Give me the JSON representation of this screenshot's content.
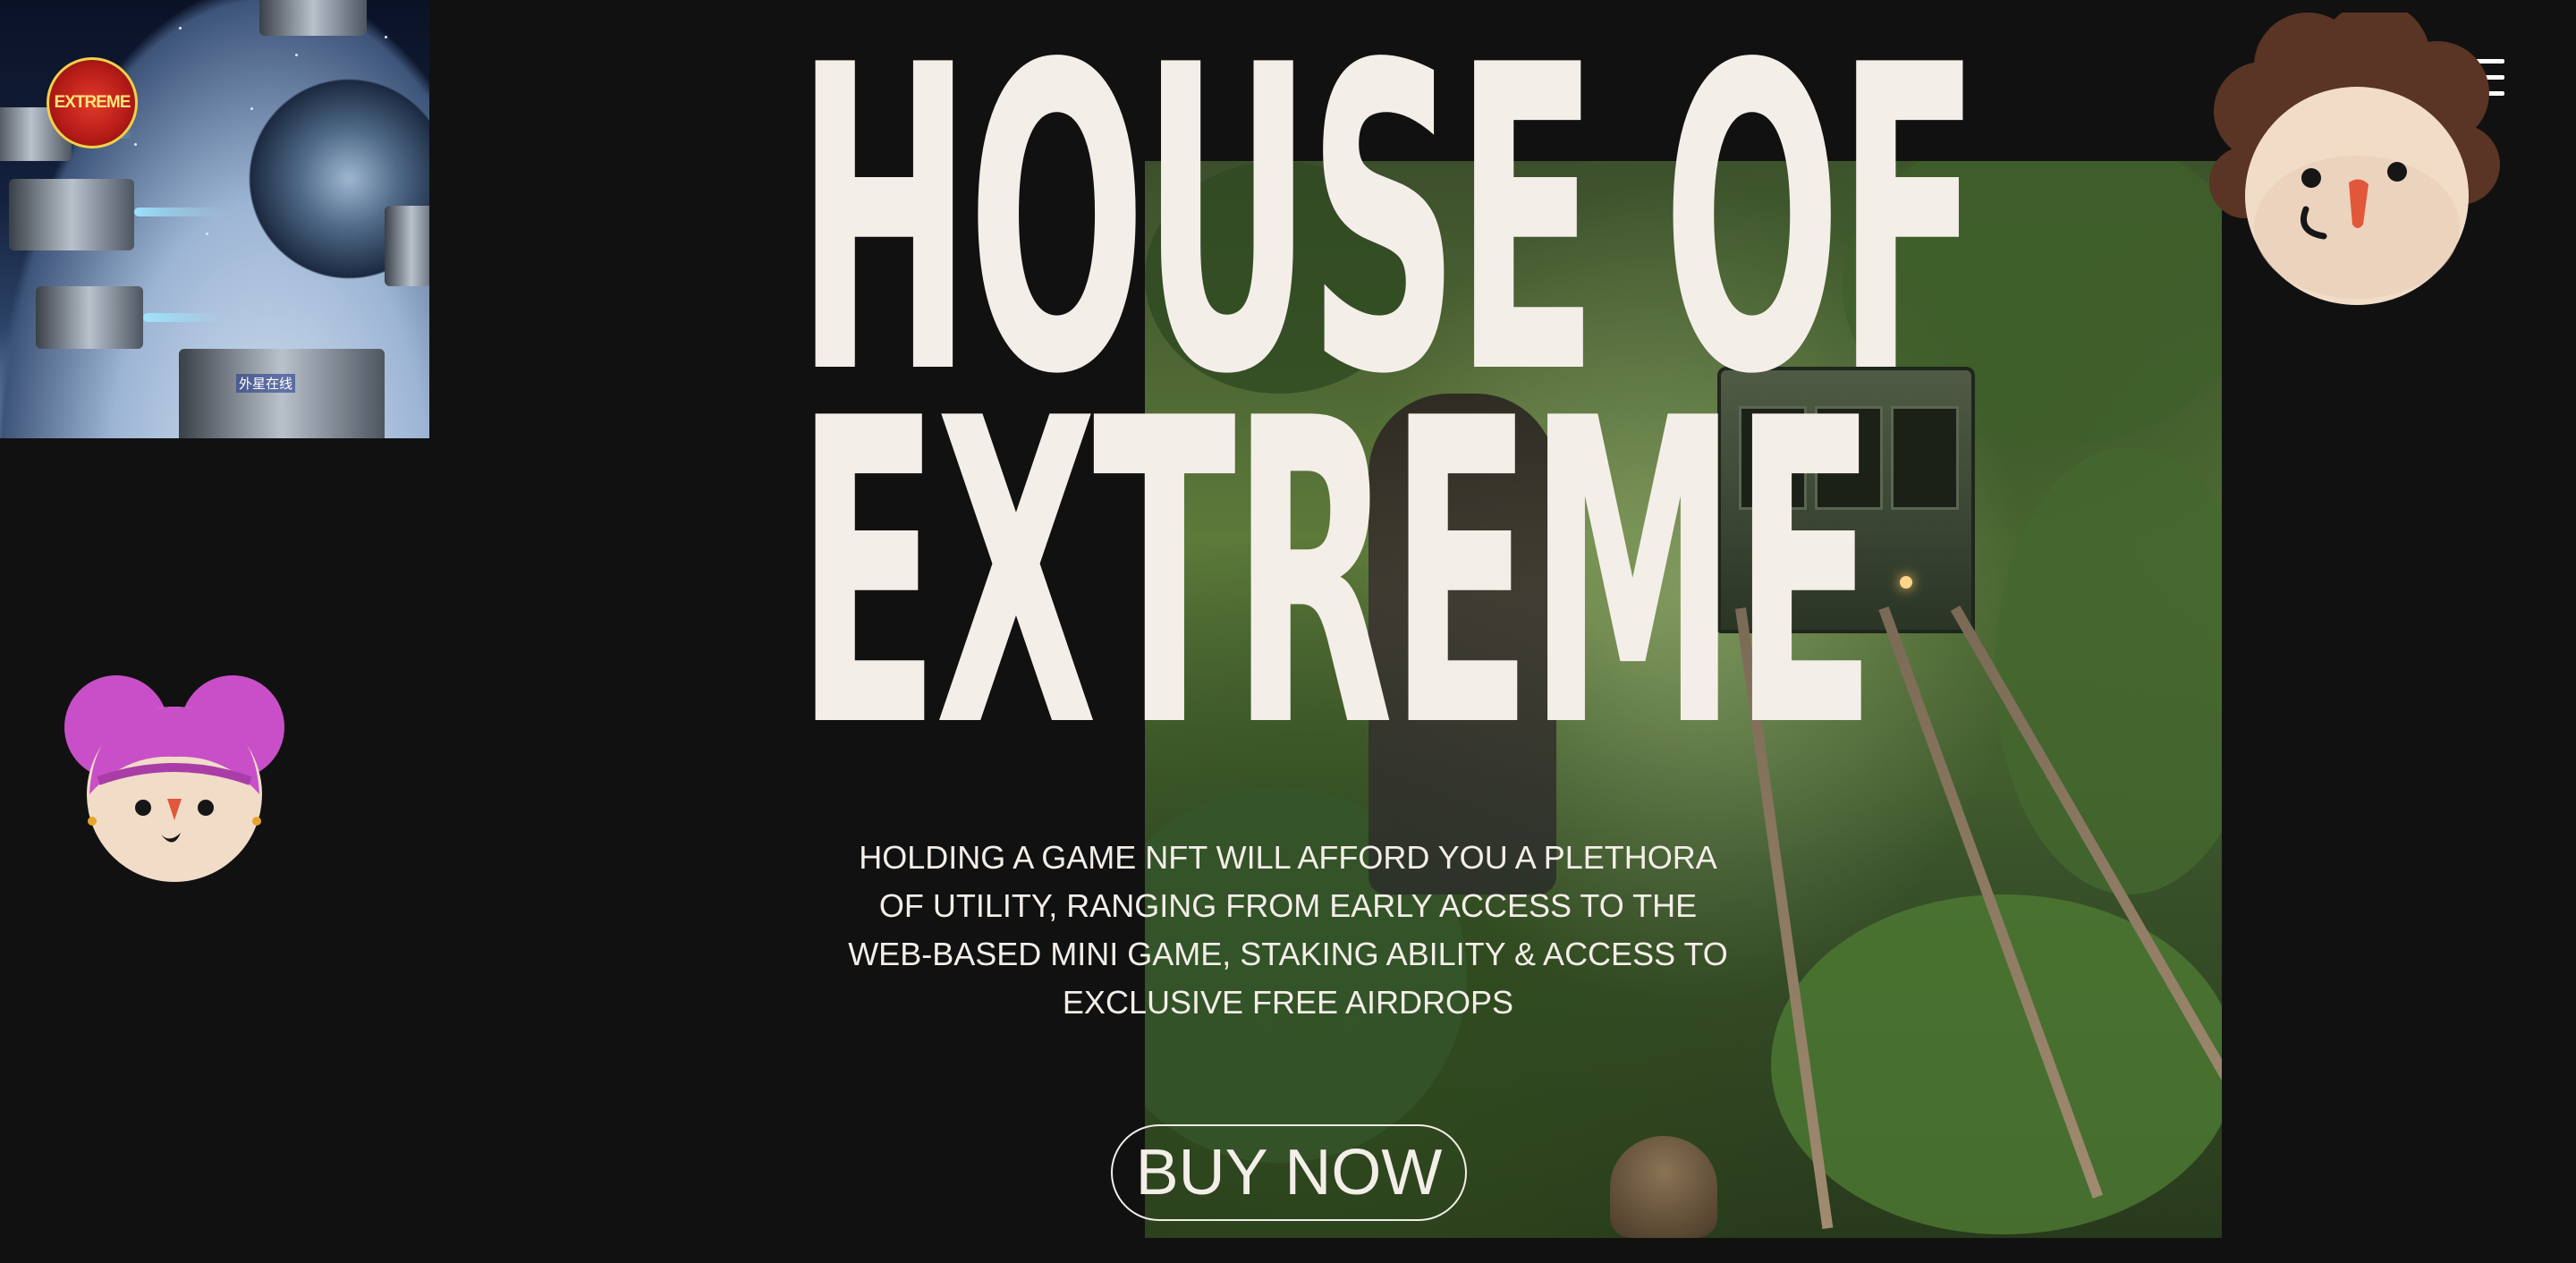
{
  "thumbnail": {
    "logo_text": "EXTREME",
    "caption": "外星在线"
  },
  "headline": {
    "line1": "HOUSE OF",
    "line2": "EXTREME"
  },
  "description": "HOLDING A GAME NFT WILL AFFORD YOU A PLETHORA OF UTILITY, RANGING FROM EARLY ACCESS TO THE WEB-BASED MINI GAME, STAKING ABILITY & ACCESS TO EXCLUSIVE FREE AIRDROPS",
  "cta": {
    "label": "BUY NOW"
  },
  "menu": {
    "icon": "hamburger-icon"
  },
  "colors": {
    "background": "#111111",
    "text": "#f4eee8",
    "girl_hair": "#c94fc8",
    "boy_hair": "#5a3424",
    "nose": "#e0573a"
  }
}
